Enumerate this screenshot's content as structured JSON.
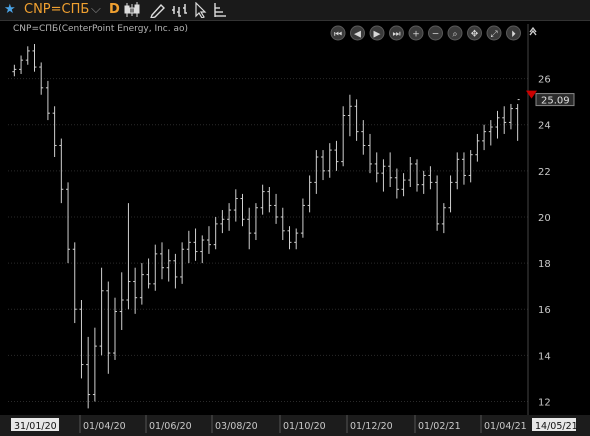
{
  "toolbar": {
    "star_icon": "star-icon",
    "ric": "CNP=СПБ",
    "ric_dropdown_icon": "chevron-down-icon",
    "frequency": "D",
    "tools": [
      "candlestick-icon",
      "pencil-icon",
      "bar-style-icon",
      "cursor-icon",
      "indicator-icon"
    ]
  },
  "chart": {
    "subtitle": "CNP=СПБ(CenterPoint Energy, Inc. ao)",
    "last_price_label": "25.09",
    "last_price_color": "#cc0000",
    "nav_buttons": [
      "first-icon",
      "prev-icon",
      "play-icon",
      "last-icon",
      "zoom-in-icon",
      "zoom-out-icon",
      "search-icon",
      "pan-icon",
      "fit-icon",
      "split-icon",
      "collapse-icon"
    ]
  },
  "chart_data": {
    "type": "ohlc",
    "ylim": [
      11.5,
      27.5
    ],
    "y_ticks": [
      "12",
      "14",
      "16",
      "18",
      "20",
      "22",
      "24",
      "26"
    ],
    "x_ticks": [
      "31/01/20",
      "01/04/20",
      "01/06/20",
      "03/08/20",
      "01/10/20",
      "01/12/20",
      "01/02/21",
      "01/04/21",
      "14/05/21"
    ],
    "series": [
      {
        "values": [
          [
            26.3,
            26.6,
            26.1,
            26.4
          ],
          [
            26.4,
            27.0,
            26.2,
            26.8
          ],
          [
            26.8,
            27.4,
            26.6,
            27.2
          ],
          [
            27.2,
            27.5,
            26.3,
            26.5
          ],
          [
            26.5,
            26.7,
            25.3,
            25.6
          ],
          [
            25.6,
            25.9,
            24.2,
            24.5
          ],
          [
            24.5,
            24.8,
            22.6,
            23.1
          ],
          [
            23.1,
            23.4,
            20.6,
            21.2
          ],
          [
            21.2,
            21.5,
            18.0,
            18.6
          ],
          [
            18.6,
            18.9,
            15.4,
            16.0
          ],
          [
            16.0,
            16.4,
            13.0,
            13.6
          ],
          [
            13.6,
            14.8,
            11.7,
            12.3
          ],
          [
            12.3,
            15.2,
            12.0,
            14.4
          ],
          [
            14.4,
            17.8,
            14.0,
            16.8
          ],
          [
            16.8,
            17.2,
            13.2,
            14.1
          ],
          [
            14.1,
            16.5,
            13.8,
            15.9
          ],
          [
            15.9,
            17.6,
            15.1,
            16.4
          ],
          [
            16.4,
            20.6,
            16.0,
            17.2
          ],
          [
            17.2,
            17.8,
            15.8,
            16.5
          ],
          [
            16.5,
            18.0,
            16.2,
            17.5
          ],
          [
            17.5,
            18.2,
            16.9,
            17.1
          ],
          [
            17.1,
            18.8,
            16.8,
            18.4
          ],
          [
            18.4,
            18.9,
            17.3,
            17.8
          ],
          [
            17.8,
            18.6,
            17.2,
            18.1
          ],
          [
            18.1,
            18.4,
            16.9,
            17.4
          ],
          [
            17.4,
            18.9,
            17.1,
            18.6
          ],
          [
            18.6,
            19.4,
            18.0,
            18.9
          ],
          [
            18.9,
            19.5,
            18.1,
            18.5
          ],
          [
            18.5,
            19.2,
            18.0,
            19.0
          ],
          [
            19.0,
            19.6,
            18.4,
            18.8
          ],
          [
            18.8,
            20.0,
            18.6,
            19.7
          ],
          [
            19.7,
            20.3,
            19.3,
            19.9
          ],
          [
            19.9,
            20.6,
            19.4,
            20.3
          ],
          [
            20.3,
            21.2,
            19.8,
            20.8
          ],
          [
            20.8,
            21.0,
            19.6,
            19.9
          ],
          [
            19.9,
            20.4,
            18.6,
            19.3
          ],
          [
            19.3,
            20.6,
            19.0,
            20.4
          ],
          [
            20.4,
            21.4,
            20.1,
            21.1
          ],
          [
            21.1,
            21.3,
            20.2,
            20.5
          ],
          [
            20.5,
            21.0,
            19.7,
            20.0
          ],
          [
            20.0,
            20.4,
            19.0,
            19.4
          ],
          [
            19.4,
            19.6,
            18.6,
            18.9
          ],
          [
            18.9,
            19.5,
            18.6,
            19.3
          ],
          [
            19.3,
            20.8,
            19.1,
            20.5
          ],
          [
            20.5,
            21.8,
            20.2,
            21.5
          ],
          [
            21.5,
            22.9,
            21.0,
            22.6
          ],
          [
            22.6,
            22.9,
            21.6,
            22.0
          ],
          [
            22.0,
            23.2,
            21.7,
            22.9
          ],
          [
            22.9,
            23.3,
            22.0,
            22.4
          ],
          [
            22.4,
            24.8,
            22.2,
            24.4
          ],
          [
            24.4,
            25.3,
            23.5,
            24.8
          ],
          [
            24.8,
            25.1,
            23.3,
            23.7
          ],
          [
            23.7,
            24.2,
            22.7,
            23.1
          ],
          [
            23.1,
            23.6,
            21.9,
            22.3
          ],
          [
            22.3,
            22.8,
            21.5,
            21.9
          ],
          [
            21.9,
            22.5,
            21.1,
            22.2
          ],
          [
            22.2,
            22.8,
            21.3,
            21.7
          ],
          [
            21.7,
            22.1,
            20.8,
            21.2
          ],
          [
            21.2,
            21.9,
            20.9,
            21.6
          ],
          [
            21.6,
            22.6,
            21.3,
            22.3
          ],
          [
            22.3,
            22.5,
            21.1,
            21.4
          ],
          [
            21.4,
            22.0,
            21.0,
            21.8
          ],
          [
            21.8,
            22.2,
            21.2,
            21.5
          ],
          [
            21.5,
            21.8,
            19.4,
            19.7
          ],
          [
            19.7,
            20.6,
            19.3,
            20.4
          ],
          [
            20.4,
            21.8,
            20.2,
            21.5
          ],
          [
            21.5,
            22.8,
            21.2,
            22.5
          ],
          [
            22.5,
            22.8,
            21.4,
            21.8
          ],
          [
            21.8,
            22.9,
            21.5,
            22.7
          ],
          [
            22.7,
            23.6,
            22.4,
            23.3
          ],
          [
            23.3,
            24.0,
            22.9,
            23.7
          ],
          [
            23.7,
            24.2,
            23.1,
            23.9
          ],
          [
            23.9,
            24.6,
            23.4,
            24.3
          ],
          [
            24.3,
            24.8,
            23.6,
            24.1
          ],
          [
            24.1,
            24.9,
            23.8,
            24.7
          ],
          [
            24.7,
            24.9,
            23.3,
            25.09
          ]
        ]
      }
    ]
  }
}
